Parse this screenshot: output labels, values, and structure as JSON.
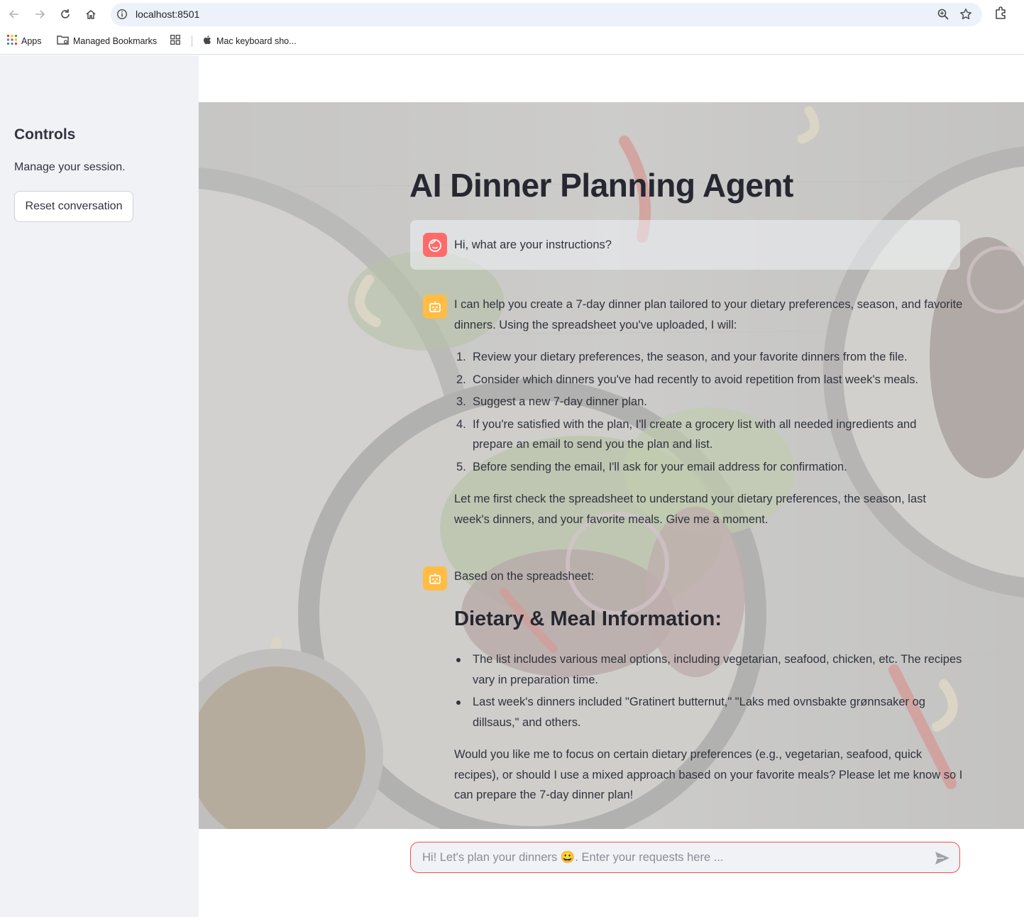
{
  "browser": {
    "url": "localhost:8501",
    "bookmarks": [
      "Apps",
      "Managed Bookmarks",
      "Mac keyboard sho..."
    ]
  },
  "sidebar": {
    "title": "Controls",
    "subtitle": "Manage your session.",
    "reset_label": "Reset conversation"
  },
  "main": {
    "title": "AI Dinner Planning Agent",
    "user_message": "Hi, what are your instructions?",
    "bot_message_1": {
      "intro_line1": "I can help you create a 7-day dinner plan tailored to your dietary preferences, season, and favorite",
      "intro_line2": "dinners. Using the spreadsheet you've uploaded, I will:",
      "steps": [
        {
          "num": "1.",
          "line1": "Review your dietary preferences, the season, and your favorite dinners from the file.",
          "line2": ""
        },
        {
          "num": "2.",
          "line1": "Consider which dinners you've had recently to avoid repetition from last week's meals.",
          "line2": ""
        },
        {
          "num": "3.",
          "line1": "Suggest a new 7-day dinner plan.",
          "line2": ""
        },
        {
          "num": "4.",
          "line1": "If you're satisfied with the plan, I'll create a grocery list with all needed ingredients and",
          "line2": "prepare an email to send you the plan and list."
        },
        {
          "num": "5.",
          "line1": "Before sending the email, I'll ask for your email address for confirmation.",
          "line2": ""
        }
      ],
      "outro_line1": "Let me first check the spreadsheet to understand your dietary preferences, the season, last",
      "outro_line2": "week's dinners, and your favorite meals. Give me a moment."
    },
    "bot_message_2": {
      "intro": "Based on the spreadsheet:",
      "heading": "Dietary & Meal Information:",
      "bullets": [
        {
          "line1": "The list includes various meal options, including vegetarian, seafood, chicken, etc. The recipes",
          "line2": "vary in preparation time."
        },
        {
          "line1": "Last week's dinners included \"Gratinert butternut,\" \"Laks med ovnsbakte grønnsaker og",
          "line2": "dillsaus,\" and others."
        }
      ],
      "question_line1": "Would you like me to focus on certain dietary preferences (e.g., vegetarian, seafood, quick",
      "question_line2": "recipes), or should I use a mixed approach based on your favorite meals? Please let me know so I",
      "question_line3": "can prepare the 7-day dinner plan!"
    },
    "chat_placeholder": "Hi! Let's plan your dinners 😀. Enter your requests here ..."
  },
  "colors": {
    "accent": "#ff4b4b",
    "user_avatar": "#ff6b6b",
    "bot_avatar": "#ffbd45",
    "sidebar_bg": "#f0f2f6"
  },
  "icons": [
    "back-arrow-icon",
    "forward-arrow-icon",
    "reload-icon",
    "home-icon",
    "site-info-icon",
    "zoom-icon",
    "bookmark-star-icon",
    "extensions-icon",
    "apps-grid-icon",
    "folder-icon",
    "apple-icon",
    "user-face-icon",
    "robot-icon",
    "send-icon"
  ]
}
